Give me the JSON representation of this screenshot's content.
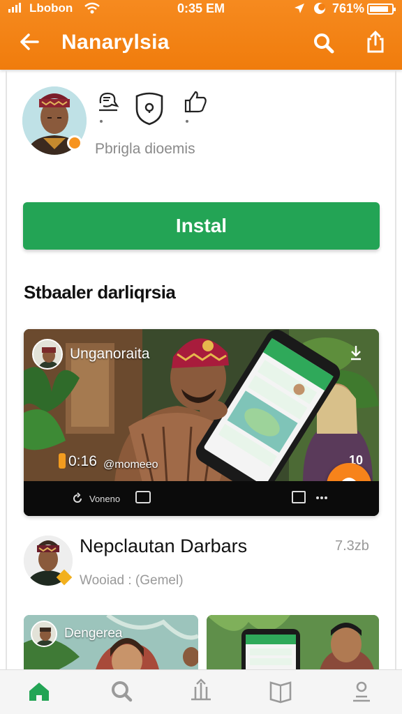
{
  "status_bar": {
    "carrier": "Lbobon",
    "time": "0:35 EM",
    "battery": "761%"
  },
  "header": {
    "title": "Nanarylsia",
    "back_icon": "arrow-left-icon",
    "search_icon": "search-icon",
    "share_icon": "share-icon"
  },
  "profile": {
    "subtitle": "Pbrigla dioemis",
    "stats_icons": [
      "chat-icon",
      "shield-badge-icon",
      "thumbs-up-icon"
    ]
  },
  "install_button": {
    "label": "Instal"
  },
  "section": {
    "heading": "Stbaaler darliqrsia"
  },
  "hero_video": {
    "channel_name": "Unganoraita",
    "counter": "0:16",
    "mention": "@momeeo",
    "right_count": "10",
    "control_label": "Voneno"
  },
  "video_meta": {
    "title": "Nepclautan Darbars",
    "views": "7.3zb",
    "subtitle": "Wooiad : (Gemel)"
  },
  "thumbnails": [
    {
      "channel_name": "Dengerea"
    },
    {
      "channel_name": ""
    }
  ],
  "bottom_nav": {
    "items": [
      "home-icon",
      "search-icon",
      "upload-icon",
      "library-icon",
      "profile-icon"
    ],
    "active": "home-icon"
  },
  "colors": {
    "header": "#f68a1f",
    "install": "#23a455",
    "accent": "#f7831a",
    "active_nav": "#23a455"
  }
}
